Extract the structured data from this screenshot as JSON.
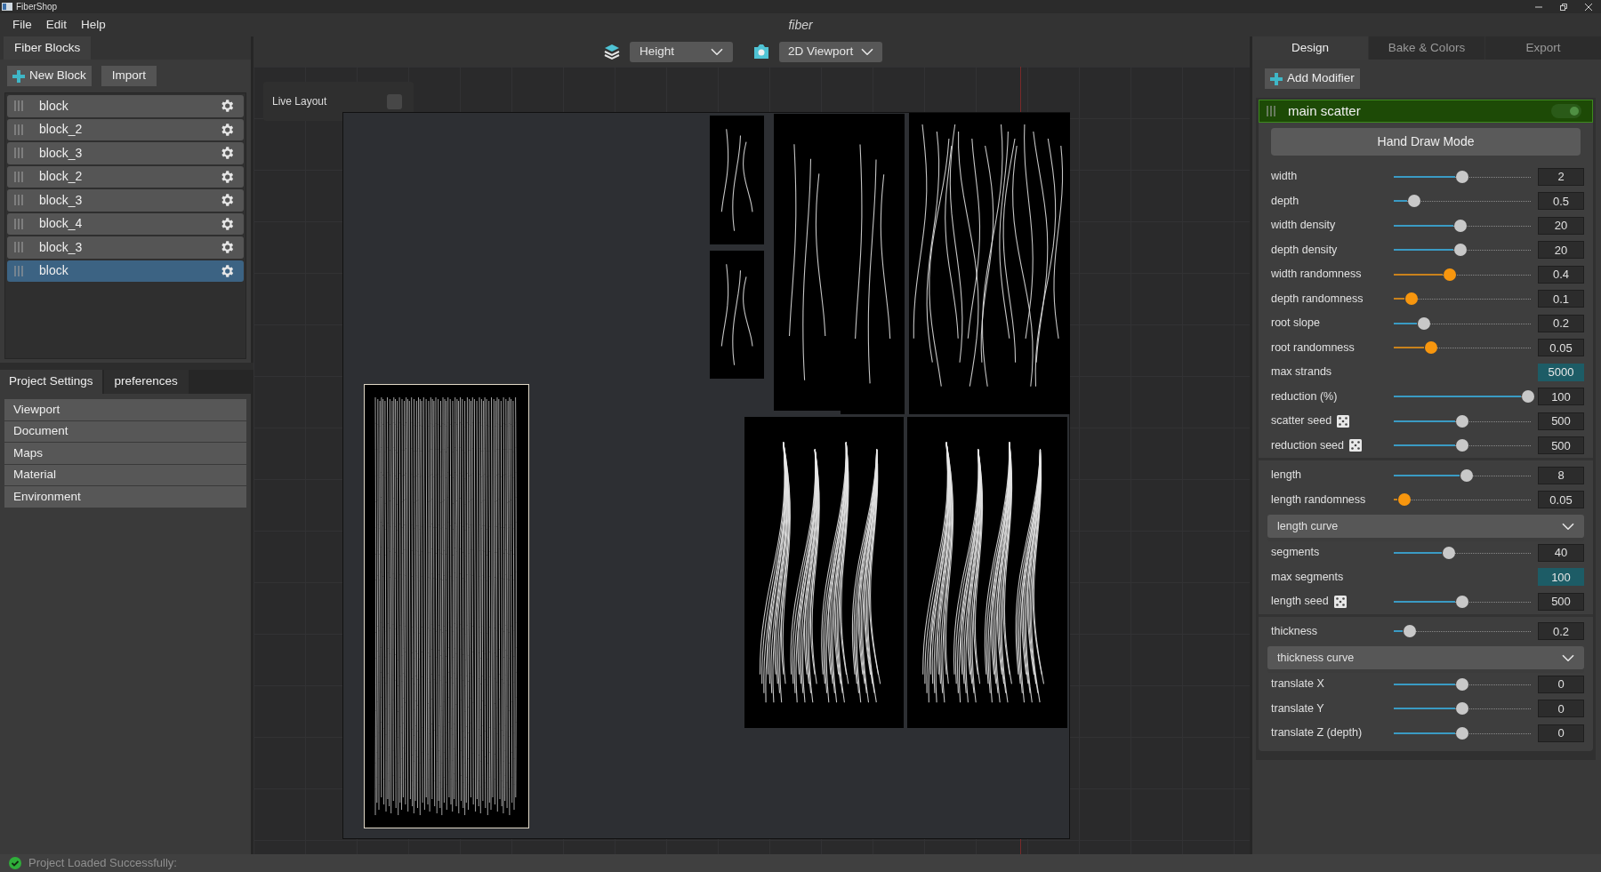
{
  "window": {
    "title": "FiberShop"
  },
  "menu": [
    "File",
    "Edit",
    "Help"
  ],
  "document_title": "fiber",
  "blocks_panel": {
    "tabs": [
      {
        "label": "Fiber Blocks",
        "selected": true
      }
    ],
    "buttons": [
      {
        "label": "New Block",
        "kind": "add"
      },
      {
        "label": "Import",
        "kind": "plain"
      }
    ],
    "blocks": [
      {
        "name": "block",
        "selected": false
      },
      {
        "name": "block_2",
        "selected": false
      },
      {
        "name": "block_3",
        "selected": false
      },
      {
        "name": "block_2",
        "selected": false
      },
      {
        "name": "block_3",
        "selected": false
      },
      {
        "name": "block_4",
        "selected": false
      },
      {
        "name": "block_3",
        "selected": false
      },
      {
        "name": "block",
        "selected": true
      }
    ]
  },
  "settings_panel": {
    "tabs": [
      {
        "label": "Project Settings",
        "selected": true
      },
      {
        "label": "preferences",
        "selected": false
      }
    ],
    "items": [
      "Viewport",
      "Document",
      "Maps",
      "Material",
      "Environment"
    ]
  },
  "viewport": {
    "map_select": "Height",
    "view_select": "2D Viewport",
    "live_layout": {
      "label": "Live Layout",
      "on": false
    },
    "images": [
      {
        "selected": false
      },
      {
        "selected": false
      },
      {
        "selected": false
      },
      {
        "selected": false
      },
      {
        "selected": false
      },
      {
        "selected": false
      },
      {
        "selected": false
      },
      {
        "selected": true
      }
    ]
  },
  "inspector": {
    "tabs": [
      {
        "label": "Design",
        "selected": true
      },
      {
        "label": "Bake & Colors",
        "selected": false
      },
      {
        "label": "Export",
        "selected": false
      }
    ],
    "add_button": "Add Modifier",
    "modifier": {
      "name": "main scatter",
      "on": true,
      "mode_button": "Hand Draw Mode",
      "sections": [
        [
          {
            "kind": "slider",
            "label": "width",
            "level": 0.5,
            "value": "2",
            "color": "#c8c8c8"
          },
          {
            "kind": "slider",
            "label": "depth",
            "level": 0.15,
            "value": "0.5",
            "color": "#c8c8c8"
          },
          {
            "kind": "slider",
            "label": "width density",
            "level": 0.49,
            "value": "20",
            "color": "#c8c8c8"
          },
          {
            "kind": "slider",
            "label": "depth density",
            "level": 0.49,
            "value": "20",
            "color": "#c8c8c8"
          },
          {
            "kind": "slider",
            "label": "width randomness",
            "level": 0.41,
            "value": "0.4",
            "color": "#f7960e"
          },
          {
            "kind": "slider",
            "label": "depth randomness",
            "level": 0.13,
            "value": "0.1",
            "color": "#f7960e"
          },
          {
            "kind": "slider",
            "label": "root slope",
            "level": 0.22,
            "value": "0.2",
            "color": "#c8c8c8"
          },
          {
            "kind": "slider",
            "label": "root randomness",
            "level": 0.27,
            "value": "0.05",
            "color": "#f7960e"
          },
          {
            "kind": "field",
            "label": "max strands",
            "value": "5000"
          },
          {
            "kind": "slider",
            "label": "reduction (%)",
            "level": 0.98,
            "value": "100",
            "color": "#c8c8c8"
          },
          {
            "kind": "seed",
            "label": "scatter seed",
            "level": 0.5,
            "value": "500",
            "color": "#c8c8c8"
          },
          {
            "kind": "seed",
            "label": "reduction seed",
            "level": 0.5,
            "value": "500",
            "color": "#c8c8c8"
          }
        ],
        [
          {
            "kind": "slider",
            "label": "length",
            "level": 0.53,
            "value": "8",
            "color": "#c8c8c8"
          },
          {
            "kind": "slider",
            "label": "length randomness",
            "level": 0.08,
            "value": "0.05",
            "color": "#f7960e"
          },
          {
            "kind": "dropdown",
            "label": "length curve"
          },
          {
            "kind": "slider",
            "label": "segments",
            "level": 0.4,
            "value": "40",
            "color": "#c8c8c8"
          },
          {
            "kind": "field",
            "label": "max segments",
            "value": "100"
          },
          {
            "kind": "seed",
            "label": "length seed",
            "level": 0.5,
            "value": "500",
            "color": "#c8c8c8"
          }
        ],
        [
          {
            "kind": "slider",
            "label": "thickness",
            "level": 0.12,
            "value": "0.2",
            "color": "#c8c8c8"
          },
          {
            "kind": "dropdown",
            "label": "thickness curve"
          },
          {
            "kind": "slider",
            "label": "translate X",
            "level": 0.5,
            "value": "0",
            "color": "#c8c8c8"
          },
          {
            "kind": "slider",
            "label": "translate Y",
            "level": 0.5,
            "value": "0",
            "color": "#c8c8c8"
          },
          {
            "kind": "slider",
            "label": "translate Z (depth)",
            "level": 0.5,
            "value": "0",
            "color": "#c8c8c8"
          }
        ]
      ]
    }
  },
  "status_bar": {
    "message": "Project Loaded Successfully:"
  }
}
